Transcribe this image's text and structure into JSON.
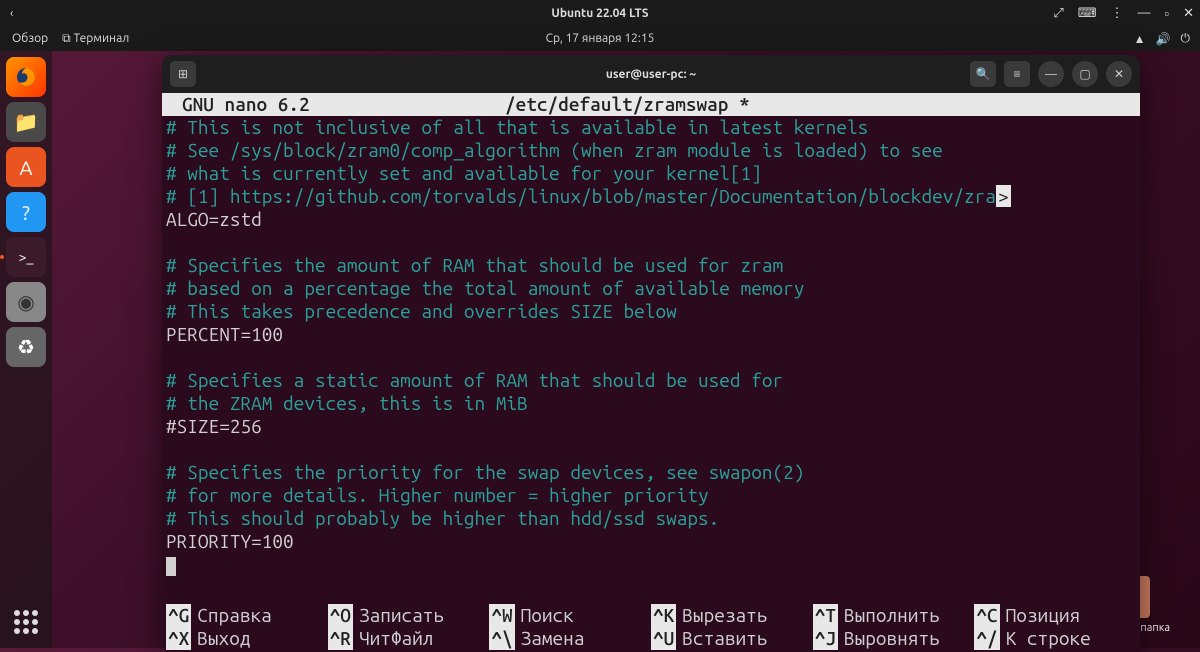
{
  "host": {
    "title": "Ubuntu 22.04 LTS",
    "back": "‹"
  },
  "gnome": {
    "activities": "Обзор",
    "app_indicator": "⧉ Терминал",
    "datetime": "Ср, 17 января  12:15"
  },
  "desktop": {
    "home_label": "Домашняя папка"
  },
  "terminal": {
    "title": "user@user-pc: ~"
  },
  "nano": {
    "header_left": "GNU nano 6.2",
    "header_file": "/etc/default/zramswap *",
    "lines": [
      {
        "t": "c",
        "v": "# This is not inclusive of all that is available in latest kernels"
      },
      {
        "t": "c",
        "v": "# See /sys/block/zram0/comp_algorithm (when zram module is loaded) to see"
      },
      {
        "t": "c",
        "v": "# what is currently set and available for your kernel[1]"
      },
      {
        "t": "co",
        "v": "# [1]  https://github.com/torvalds/linux/blob/master/Documentation/blockdev/zra",
        "o": ">"
      },
      {
        "t": "s",
        "v": "ALGO=zstd"
      },
      {
        "t": "b",
        "v": ""
      },
      {
        "t": "c",
        "v": "# Specifies the amount of RAM that should be used for zram"
      },
      {
        "t": "c",
        "v": "# based on a percentage the total amount of available memory"
      },
      {
        "t": "c",
        "v": "# This takes precedence and overrides SIZE below"
      },
      {
        "t": "s",
        "v": "PERCENT=100"
      },
      {
        "t": "b",
        "v": ""
      },
      {
        "t": "c",
        "v": "# Specifies a static amount of RAM that should be used for"
      },
      {
        "t": "c",
        "v": "# the ZRAM devices, this is in MiB"
      },
      {
        "t": "s",
        "v": "#SIZE=256"
      },
      {
        "t": "b",
        "v": ""
      },
      {
        "t": "c",
        "v": "# Specifies the priority for the swap devices, see swapon(2)"
      },
      {
        "t": "c",
        "v": "# for more details. Higher number = higher priority"
      },
      {
        "t": "c",
        "v": "# This should probably be higher than hdd/ssd swaps."
      },
      {
        "t": "s",
        "v": "PRIORITY=100"
      },
      {
        "t": "cur",
        "v": ""
      }
    ],
    "shortcuts_row1": [
      {
        "k": "^G",
        "l": "Справка"
      },
      {
        "k": "^O",
        "l": "Записать"
      },
      {
        "k": "^W",
        "l": "Поиск"
      },
      {
        "k": "^K",
        "l": "Вырезать"
      },
      {
        "k": "^T",
        "l": "Выполнить"
      },
      {
        "k": "^C",
        "l": "Позиция"
      }
    ],
    "shortcuts_row2": [
      {
        "k": "^X",
        "l": "Выход"
      },
      {
        "k": "^R",
        "l": "ЧитФайл"
      },
      {
        "k": "^\\",
        "l": "Замена"
      },
      {
        "k": "^U",
        "l": "Вставить"
      },
      {
        "k": "^J",
        "l": "Выровнять"
      },
      {
        "k": "^/",
        "l": "К строке"
      }
    ]
  }
}
